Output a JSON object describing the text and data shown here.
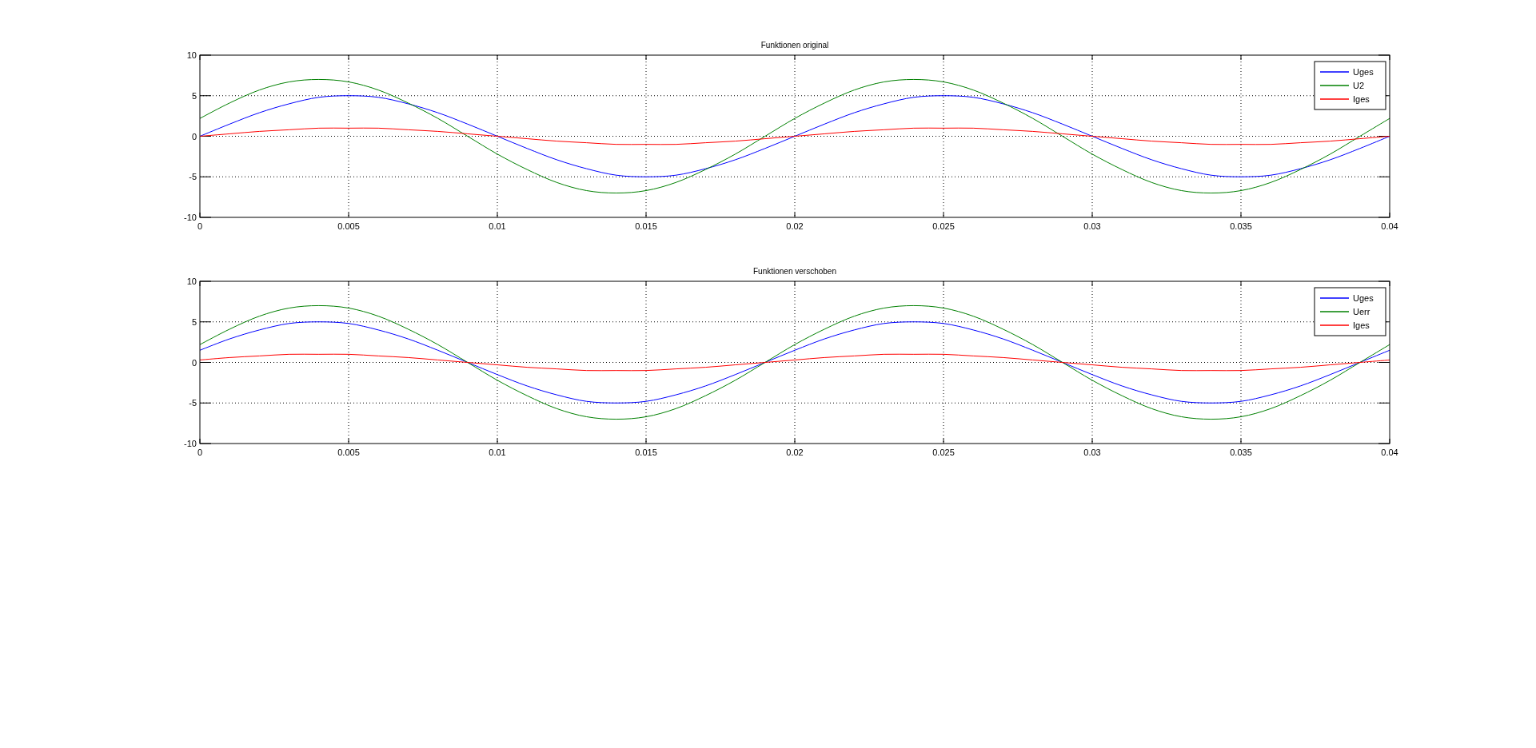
{
  "figure": {
    "plots": [
      {
        "chart_data": {
          "type": "line",
          "title": "Funktionen original",
          "x": [
            0,
            0.001,
            0.002,
            0.003,
            0.004,
            0.005,
            0.006,
            0.007,
            0.008,
            0.009,
            0.01,
            0.011,
            0.012,
            0.013,
            0.014,
            0.015,
            0.016,
            0.017,
            0.018,
            0.019,
            0.02,
            0.021,
            0.022,
            0.023,
            0.024,
            0.025,
            0.026,
            0.027,
            0.028,
            0.029,
            0.03,
            0.031,
            0.032,
            0.033,
            0.034,
            0.035,
            0.036,
            0.037,
            0.038,
            0.039,
            0.04
          ],
          "series": [
            {
              "name": "Uges",
              "color": "#0000ff",
              "values": [
                0,
                1.5,
                2.9,
                4,
                4.8,
                5,
                4.8,
                4,
                2.9,
                1.5,
                0,
                -1.5,
                -2.9,
                -4,
                -4.8,
                -5,
                -4.8,
                -4,
                -2.9,
                -1.5,
                0,
                1.5,
                2.9,
                4,
                4.8,
                5,
                4.8,
                4,
                2.9,
                1.5,
                0,
                -1.5,
                -2.9,
                -4,
                -4.8,
                -5,
                -4.8,
                -4,
                -2.9,
                -1.5,
                0
              ]
            },
            {
              "name": "U2",
              "color": "#008000",
              "values": [
                2.2,
                4.1,
                5.7,
                6.7,
                7,
                6.7,
                5.7,
                4.1,
                2.2,
                0,
                -2.2,
                -4.1,
                -5.7,
                -6.7,
                -7,
                -6.7,
                -5.7,
                -4.1,
                -2.2,
                0,
                2.2,
                4.1,
                5.7,
                6.7,
                7,
                6.7,
                5.7,
                4.1,
                2.2,
                0,
                -2.2,
                -4.1,
                -5.7,
                -6.7,
                -7,
                -6.7,
                -5.7,
                -4.1,
                -2.2,
                0,
                2.2
              ]
            },
            {
              "name": "Iges",
              "color": "#ff0000",
              "values": [
                0,
                0.3,
                0.6,
                0.8,
                1,
                1,
                1,
                0.8,
                0.6,
                0.3,
                0,
                -0.3,
                -0.6,
                -0.8,
                -1,
                -1,
                -1,
                -0.8,
                -0.6,
                -0.3,
                0,
                0.3,
                0.6,
                0.8,
                1,
                1,
                1,
                0.8,
                0.6,
                0.3,
                0,
                -0.3,
                -0.6,
                -0.8,
                -1,
                -1,
                -1,
                -0.8,
                -0.6,
                -0.3,
                0
              ]
            }
          ],
          "xlim": [
            0,
            0.04
          ],
          "ylim": [
            -10,
            10
          ],
          "xticks": [
            0,
            0.005,
            0.01,
            0.015,
            0.02,
            0.025,
            0.03,
            0.035,
            0.04
          ],
          "yticks": [
            -10,
            -5,
            0,
            5,
            10
          ],
          "grid": true,
          "legend": true
        }
      },
      {
        "chart_data": {
          "type": "line",
          "title": "Funktionen verschoben",
          "x": [
            0,
            0.001,
            0.002,
            0.003,
            0.004,
            0.005,
            0.006,
            0.007,
            0.008,
            0.009,
            0.01,
            0.011,
            0.012,
            0.013,
            0.014,
            0.015,
            0.016,
            0.017,
            0.018,
            0.019,
            0.02,
            0.021,
            0.022,
            0.023,
            0.024,
            0.025,
            0.026,
            0.027,
            0.028,
            0.029,
            0.03,
            0.031,
            0.032,
            0.033,
            0.034,
            0.035,
            0.036,
            0.037,
            0.038,
            0.039,
            0.04
          ],
          "series": [
            {
              "name": "Uges",
              "color": "#0000ff",
              "values": [
                1.5,
                2.9,
                4,
                4.8,
                5,
                4.8,
                4,
                2.9,
                1.5,
                0,
                -1.5,
                -2.9,
                -4,
                -4.8,
                -5,
                -4.8,
                -4,
                -2.9,
                -1.5,
                0,
                1.5,
                2.9,
                4,
                4.8,
                5,
                4.8,
                4,
                2.9,
                1.5,
                0,
                -1.5,
                -2.9,
                -4,
                -4.8,
                -5,
                -4.8,
                -4,
                -2.9,
                -1.5,
                0,
                1.5
              ]
            },
            {
              "name": "Uerr",
              "color": "#008000",
              "values": [
                2.2,
                4.1,
                5.7,
                6.7,
                7,
                6.7,
                5.7,
                4.1,
                2.2,
                0,
                -2.2,
                -4.1,
                -5.7,
                -6.7,
                -7,
                -6.7,
                -5.7,
                -4.1,
                -2.2,
                0,
                2.2,
                4.1,
                5.7,
                6.7,
                7,
                6.7,
                5.7,
                4.1,
                2.2,
                0,
                -2.2,
                -4.1,
                -5.7,
                -6.7,
                -7,
                -6.7,
                -5.7,
                -4.1,
                -2.2,
                0,
                2.2
              ]
            },
            {
              "name": "Iges",
              "color": "#ff0000",
              "values": [
                0.3,
                0.6,
                0.8,
                1,
                1,
                1,
                0.8,
                0.6,
                0.3,
                0,
                -0.3,
                -0.6,
                -0.8,
                -1,
                -1,
                -1,
                -0.8,
                -0.6,
                -0.3,
                0,
                0.3,
                0.6,
                0.8,
                1,
                1,
                1,
                0.8,
                0.6,
                0.3,
                0,
                -0.3,
                -0.6,
                -0.8,
                -1,
                -1,
                -1,
                -0.8,
                -0.6,
                -0.3,
                0,
                0.3
              ]
            }
          ],
          "xlim": [
            0,
            0.04
          ],
          "ylim": [
            -10,
            10
          ],
          "xticks": [
            0,
            0.005,
            0.01,
            0.015,
            0.02,
            0.025,
            0.03,
            0.035,
            0.04
          ],
          "yticks": [
            -10,
            -5,
            0,
            5,
            10
          ],
          "grid": true,
          "legend": true
        }
      }
    ]
  }
}
